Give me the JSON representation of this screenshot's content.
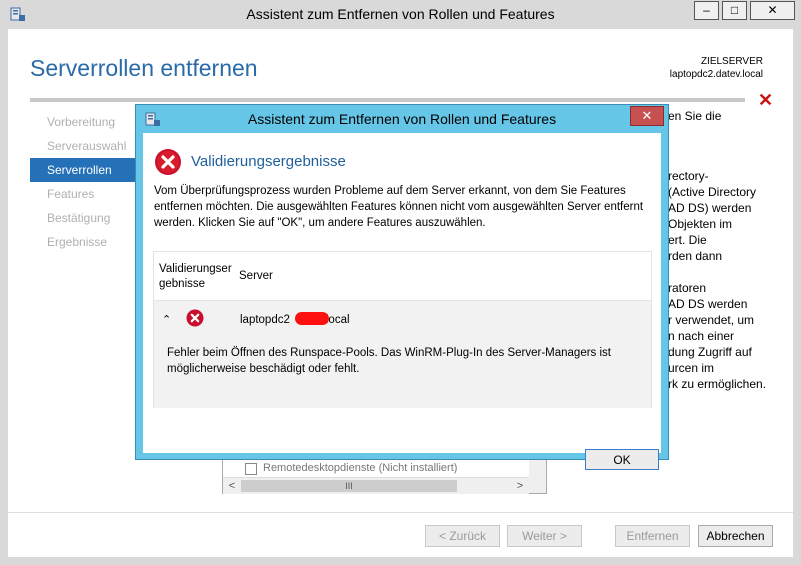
{
  "main_window": {
    "title": "Assistent zum Entfernen von Rollen und Features",
    "minimize": "–",
    "maximize": "□",
    "close": "✕",
    "page_title": "Serverrollen entfernen",
    "target_label": "ZIELSERVER",
    "target_name": "laptopdc2.datev.local",
    "nav": [
      "Vorbereitung",
      "Serverauswahl",
      "Serverrollen",
      "Features",
      "Bestätigung",
      "Ergebnisse"
    ],
    "background_text": [
      "en Sie die",
      "",
      "",
      "",
      "rectory-",
      "(Active Directory",
      "AD DS) werden",
      "Objekten im",
      "ert. Die",
      "rden dann",
      "",
      "ratoren",
      "AD DS werden",
      "r verwendet, um",
      "n nach einer",
      "dung Zugriff auf",
      "urcen im",
      "rk zu ermöglichen."
    ],
    "list_item": "Remotedesktopdienste (Nicht installiert)",
    "scroll_thumb": "III",
    "buttons": {
      "back": "< Zurück",
      "next": "Weiter >",
      "remove": "Entfernen",
      "cancel": "Abbrechen"
    }
  },
  "dialog": {
    "title": "Assistent zum Entfernen von Rollen und Features",
    "close": "✕",
    "heading": "Validierungsergebnisse",
    "message": "Vom Überprüfungsprozess wurden Probleme auf dem Server erkannt, von dem Sie Features entfernen möchten. Die ausgewählten Features können nicht vom ausgewählten Server entfernt werden. Klicken Sie auf \"OK\", um andere Features auszuwählen.",
    "col_results": "Validierungser gebnisse",
    "col_server": "Server",
    "server_prefix": "laptopdc2",
    "server_suffix": "local",
    "detail": "Fehler beim Öffnen des Runspace-Pools. Das WinRM-Plug-In des Server-Managers ist möglicherweise beschädigt oder fehlt.",
    "ok": "OK"
  },
  "colors": {
    "accent": "#2571b8",
    "heading_blue": "#2a6aa8",
    "dialog_frame": "#66c6e8",
    "error_red": "#cc1111"
  },
  "icons": [
    "app-icon",
    "error-icon",
    "chevron-up-icon",
    "close-icon"
  ]
}
